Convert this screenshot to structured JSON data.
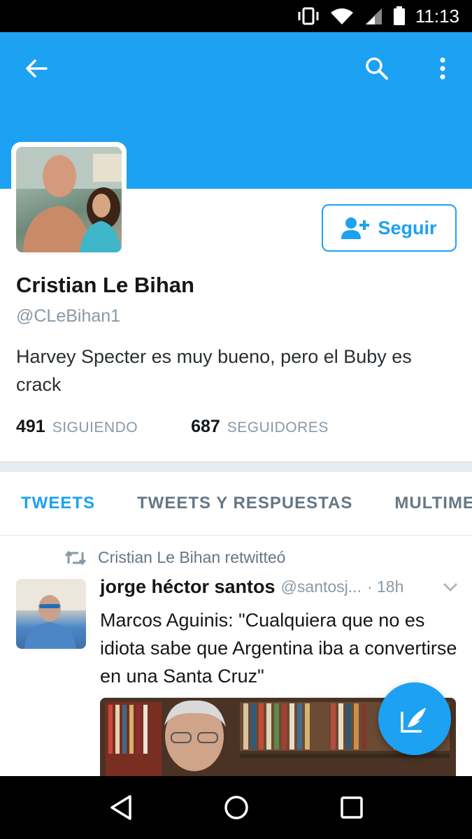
{
  "status_bar": {
    "time": "11:13",
    "icons": [
      "vibrate-icon",
      "wifi-icon",
      "signal-icon",
      "battery-icon"
    ]
  },
  "header": {
    "color": "#1da1f2",
    "icons": [
      "back-arrow-icon",
      "search-icon",
      "more-vert-icon"
    ]
  },
  "profile": {
    "name": "Cristian Le Bihan",
    "handle": "@CLeBihan1",
    "bio": "Harvey Specter es muy bueno, pero el Buby es crack",
    "follow_label": "Seguir",
    "following_count": "491",
    "following_label": "SIGUIENDO",
    "followers_count": "687",
    "followers_label": "SEGUIDORES"
  },
  "tabs": [
    {
      "label": "TWEETS",
      "active": true
    },
    {
      "label": "TWEETS Y RESPUESTAS",
      "active": false
    },
    {
      "label": "MULTIMEDIA",
      "active": false
    }
  ],
  "tweet": {
    "retweet_text": "Cristian Le Bihan retwitteó",
    "author": "jorge héctor santos",
    "handle": "@santosj...",
    "time": "· 18h",
    "text": "Marcos Aguinis: \"Cualquiera que no es idiota sabe que Argentina iba a convertirse en una Santa Cruz\""
  },
  "fab": {
    "icon": "compose-tweet-icon"
  },
  "nav": {
    "icons": [
      "back-triangle-icon",
      "home-circle-icon",
      "recents-square-icon"
    ]
  },
  "colors": {
    "accent": "#1da1f2",
    "muted": "#8899a6"
  }
}
